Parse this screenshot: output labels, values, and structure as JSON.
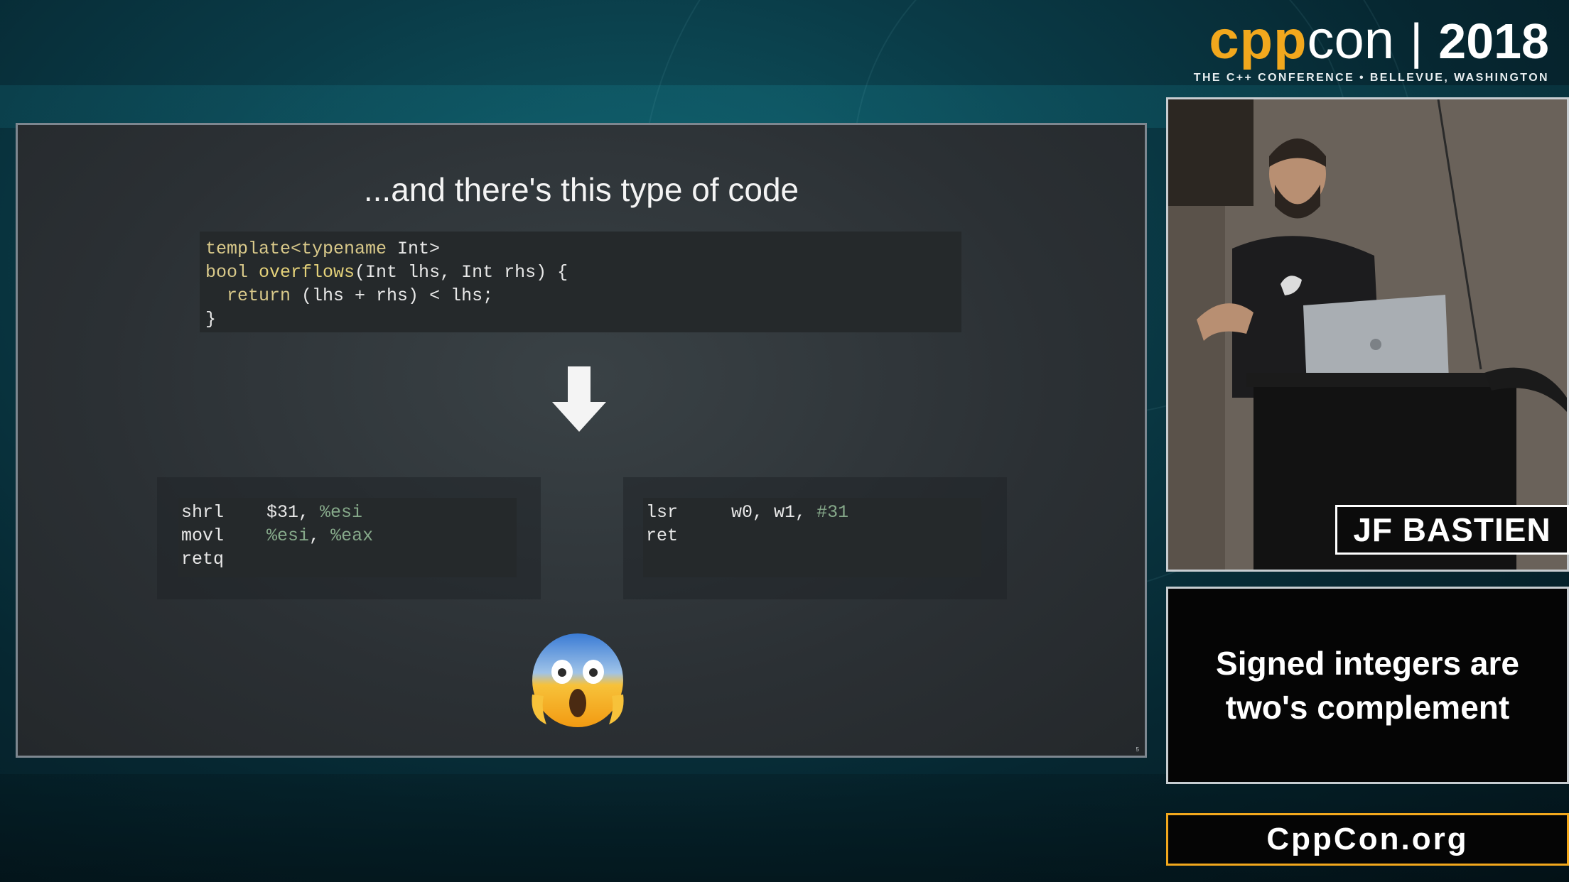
{
  "logo": {
    "cpp": "cpp",
    "con": "con",
    "separator": "|",
    "year": "2018",
    "tagline": "THE C++ CONFERENCE • BELLEVUE, WASHINGTON",
    "accent_color": "#f2a81d"
  },
  "slide": {
    "title": "...and there's this type of code",
    "code_lines": [
      {
        "kw": "template<typename",
        "rest": " Int>"
      },
      {
        "kw": "bool ",
        "fn": "overflows",
        "rest": "(Int lhs, Int rhs) {"
      },
      {
        "indent": "  ",
        "kw": "return",
        "rest": " (lhs + rhs) < lhs;"
      },
      {
        "rest": "}"
      }
    ],
    "arrow_icon": "down-arrow-icon",
    "asm_x86": [
      {
        "op": "shrl",
        "args": "$31, ",
        "reg": "%esi"
      },
      {
        "op": "movl",
        "reg": "%esi",
        "args2": ", ",
        "reg2": "%eax"
      },
      {
        "op": "retq"
      }
    ],
    "asm_arm": [
      {
        "op": "lsr",
        "args": "w0, w1, ",
        "reg": "#31"
      },
      {
        "op": "ret"
      }
    ],
    "emoji": "face-screaming-in-fear-icon",
    "page_number": "5"
  },
  "speaker": {
    "name": "JF BASTIEN"
  },
  "caption": {
    "text": "Signed integers are two's complement"
  },
  "website": {
    "label": "CppCon.org"
  }
}
